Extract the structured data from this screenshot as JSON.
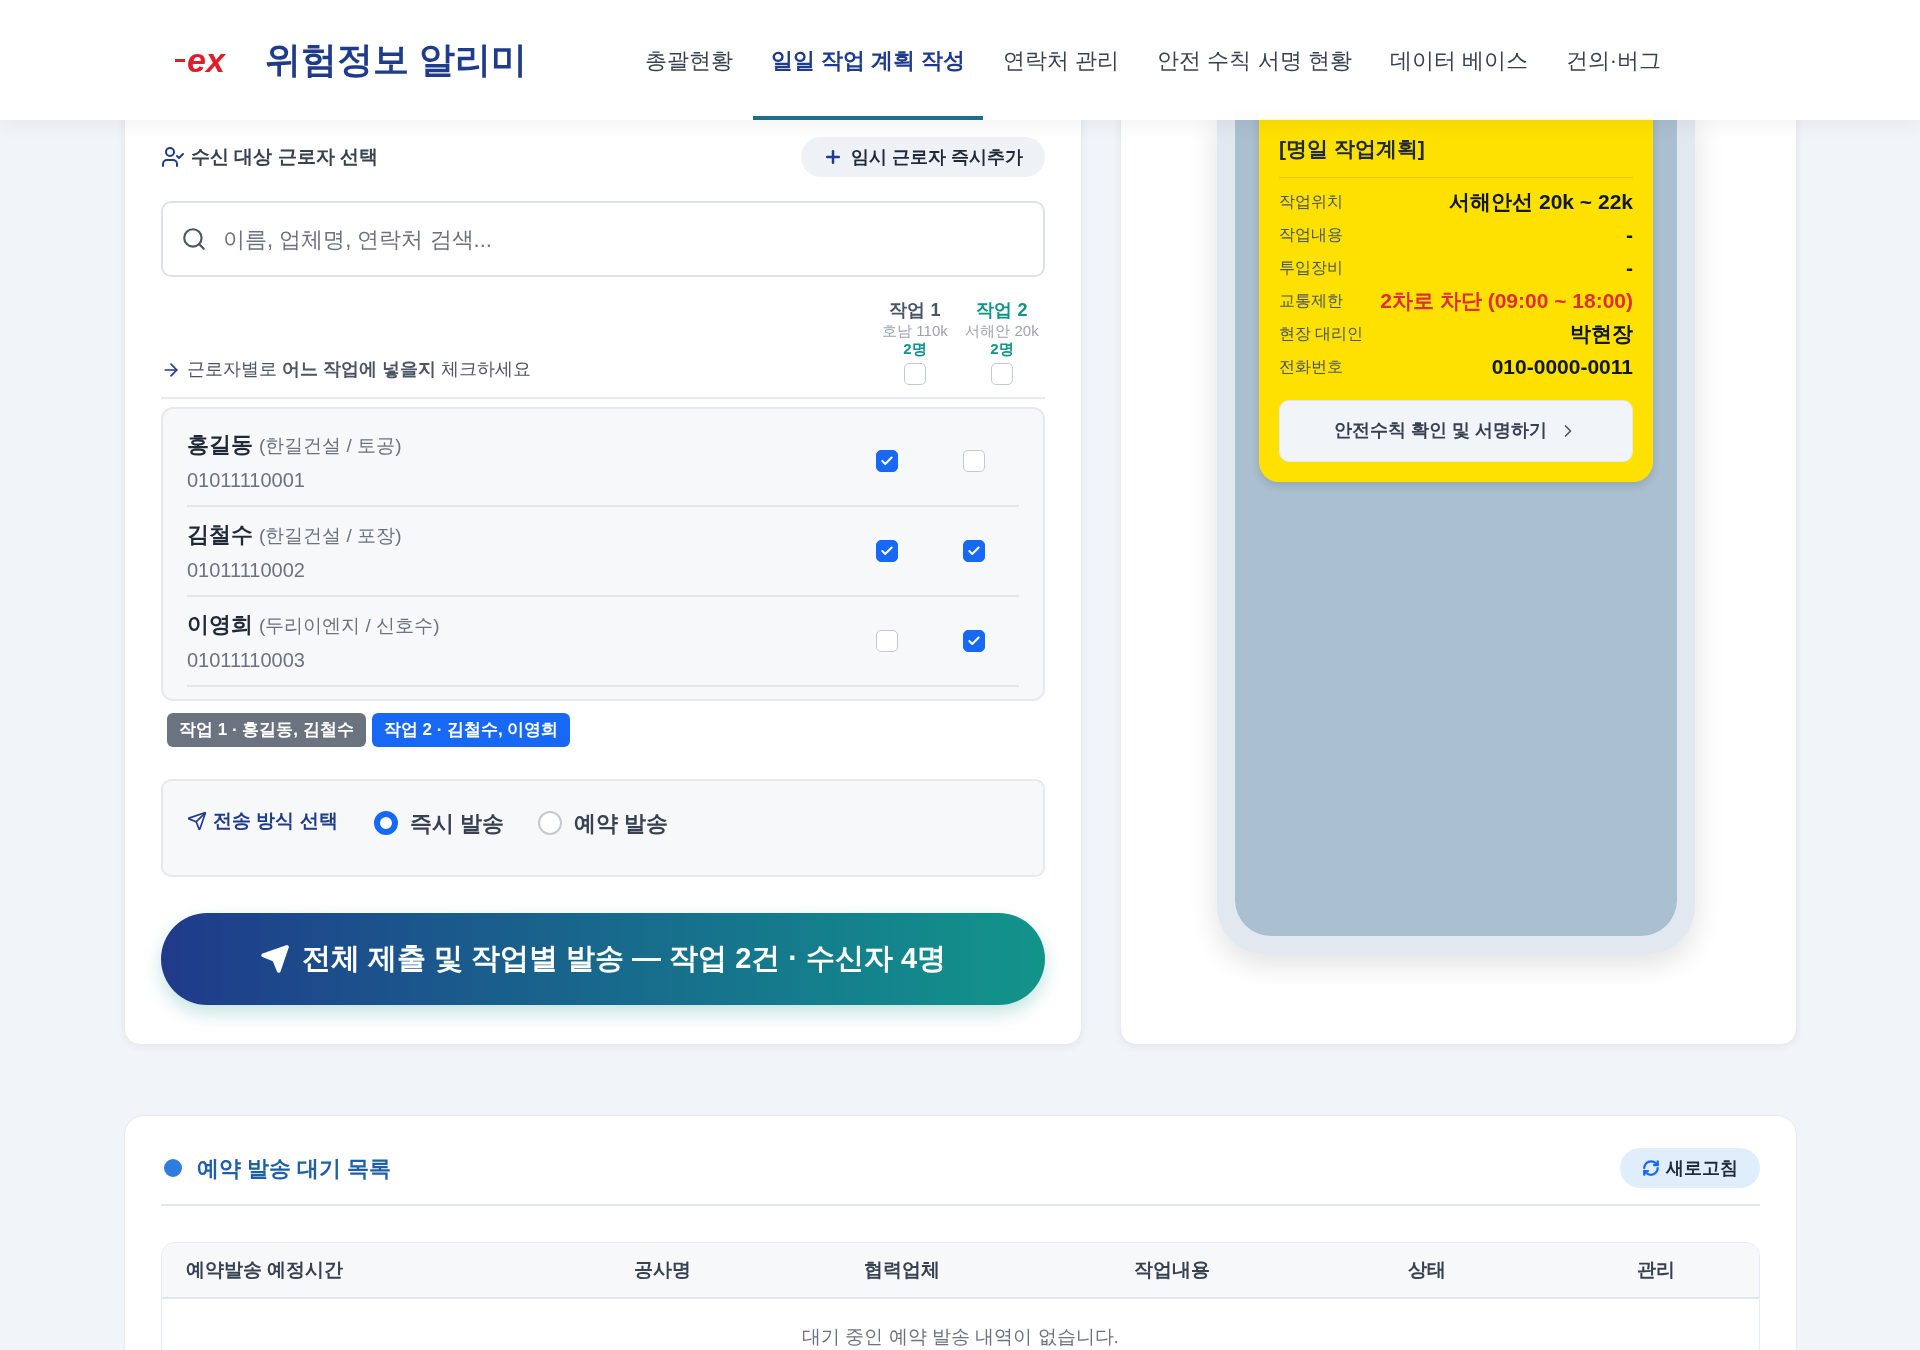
{
  "header": {
    "logo_text": "ex",
    "app_title": "위험정보 알리미",
    "nav": [
      {
        "label": "총괄현황",
        "selected": false
      },
      {
        "label": "일일 작업 계획 작성",
        "selected": true
      },
      {
        "label": "연락처 관리",
        "selected": false
      },
      {
        "label": "안전 수칙 서명 현황",
        "selected": false
      },
      {
        "label": "데이터 베이스",
        "selected": false
      },
      {
        "label": "건의·버그",
        "selected": false
      }
    ]
  },
  "worker_panel": {
    "title": "수신 대상 근로자 선택",
    "add_button": "임시 근로자 즉시추가",
    "search": {
      "placeholder": "이름, 업체명, 연락처 검색..."
    },
    "instruction": "근로자별로 **어느 작업에 넣을지** 체크하세요",
    "jobs": [
      {
        "label": "작업 1",
        "location": "호남 110k",
        "count": "2명",
        "color": "#475569",
        "checked": false
      },
      {
        "label": "작업 2",
        "location": "서해안 20k",
        "count": "2명",
        "color": "#0f9488",
        "checked": false
      }
    ],
    "workers": [
      {
        "name": "홍길동",
        "company": "(한길건설 / 토공)",
        "phone": "01011110001",
        "jobs": [
          true,
          false
        ]
      },
      {
        "name": "김철수",
        "company": "(한길건설 / 포장)",
        "phone": "01011110002",
        "jobs": [
          true,
          true
        ]
      },
      {
        "name": "이영희",
        "company": "(두리이엔지 / 신호수)",
        "phone": "01011110003",
        "jobs": [
          false,
          true
        ]
      }
    ],
    "summary_tags": [
      {
        "label": "작업 1 · 홍길동, 김철수",
        "color": "#6b7280"
      },
      {
        "label": "작업 2 · 김철수, 이영희",
        "color": "#1769f5"
      }
    ],
    "send_method": {
      "title": "전송 방식 선택",
      "options": [
        {
          "label": "즉시 발송",
          "selected": true
        },
        {
          "label": "예약 발송",
          "selected": false
        }
      ]
    },
    "submit_button": "전체 제출 및 작업별 발송 — 작업 2건 · 수신자 4명"
  },
  "preview": {
    "subtitle": "[명일 작업계획]",
    "rows": [
      {
        "label": "작업위치",
        "value": "서해안선 20k ~ 22k",
        "kind": "normal"
      },
      {
        "label": "작업내용",
        "value": "-",
        "kind": "normal"
      },
      {
        "label": "투입장비",
        "value": "-",
        "kind": "normal"
      },
      {
        "label": "교통제한",
        "value": "2차로 차단 (09:00 ~ 18:00)",
        "kind": "alert"
      },
      {
        "label": "현장 대리인",
        "value": "박현장",
        "kind": "normal"
      },
      {
        "label": "전화번호",
        "value": "010-0000-0011",
        "kind": "normal"
      }
    ],
    "button": "안전수칙 확인 및 서명하기"
  },
  "queue": {
    "title": "예약 발송 대기 목록",
    "refresh_button": "새로고침",
    "columns": [
      "예약발송 예정시간",
      "공사명",
      "협력업체",
      "작업내용",
      "상태",
      "관리"
    ],
    "empty_message": "대기 중인 예약 발송 내역이 없습니다."
  }
}
